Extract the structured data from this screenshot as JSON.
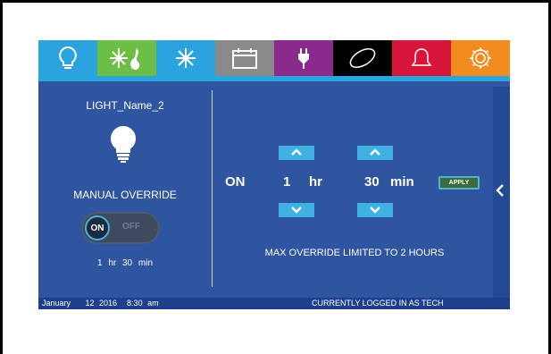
{
  "tabs": [
    {
      "name": "lighting",
      "icon": "light-bulb-icon",
      "color": "#2aa3df"
    },
    {
      "name": "heat-cool",
      "icon": "heat-cool-icon",
      "color": "#6cbf46"
    },
    {
      "name": "cooling",
      "icon": "snowflake-icon",
      "color": "#2aa3df"
    },
    {
      "name": "schedule",
      "icon": "calendar-icon",
      "color": "#8a8a8a"
    },
    {
      "name": "power",
      "icon": "plug-icon",
      "color": "#8a2a8c"
    },
    {
      "name": "sensor",
      "icon": "oval-icon",
      "color": "#000000"
    },
    {
      "name": "alarms",
      "icon": "bell-icon",
      "color": "#d7143a"
    },
    {
      "name": "settings",
      "icon": "gear-icon",
      "color": "#f28c1e"
    }
  ],
  "device": {
    "name": "LIGHT_Name_2",
    "override_label": "MANUAL OVERRIDE",
    "toggle_on": "ON",
    "toggle_off": "OFF",
    "remaining": "1 hr 30 min"
  },
  "timer": {
    "state": "ON",
    "hours": "1",
    "hours_unit": "hr",
    "minutes": "30",
    "minutes_unit": "min",
    "apply_label": "APPLY",
    "note": "MAX OVERRIDE LIMITED TO 2 HOURS"
  },
  "status_bar": {
    "date": "January   12 2016  8:30 am",
    "login": "CURRENTLY LOGGED IN AS TECH"
  },
  "colors": {
    "panel": "#2f54a0",
    "accent": "#3fb1e3",
    "stripe": "#29a6e0"
  }
}
